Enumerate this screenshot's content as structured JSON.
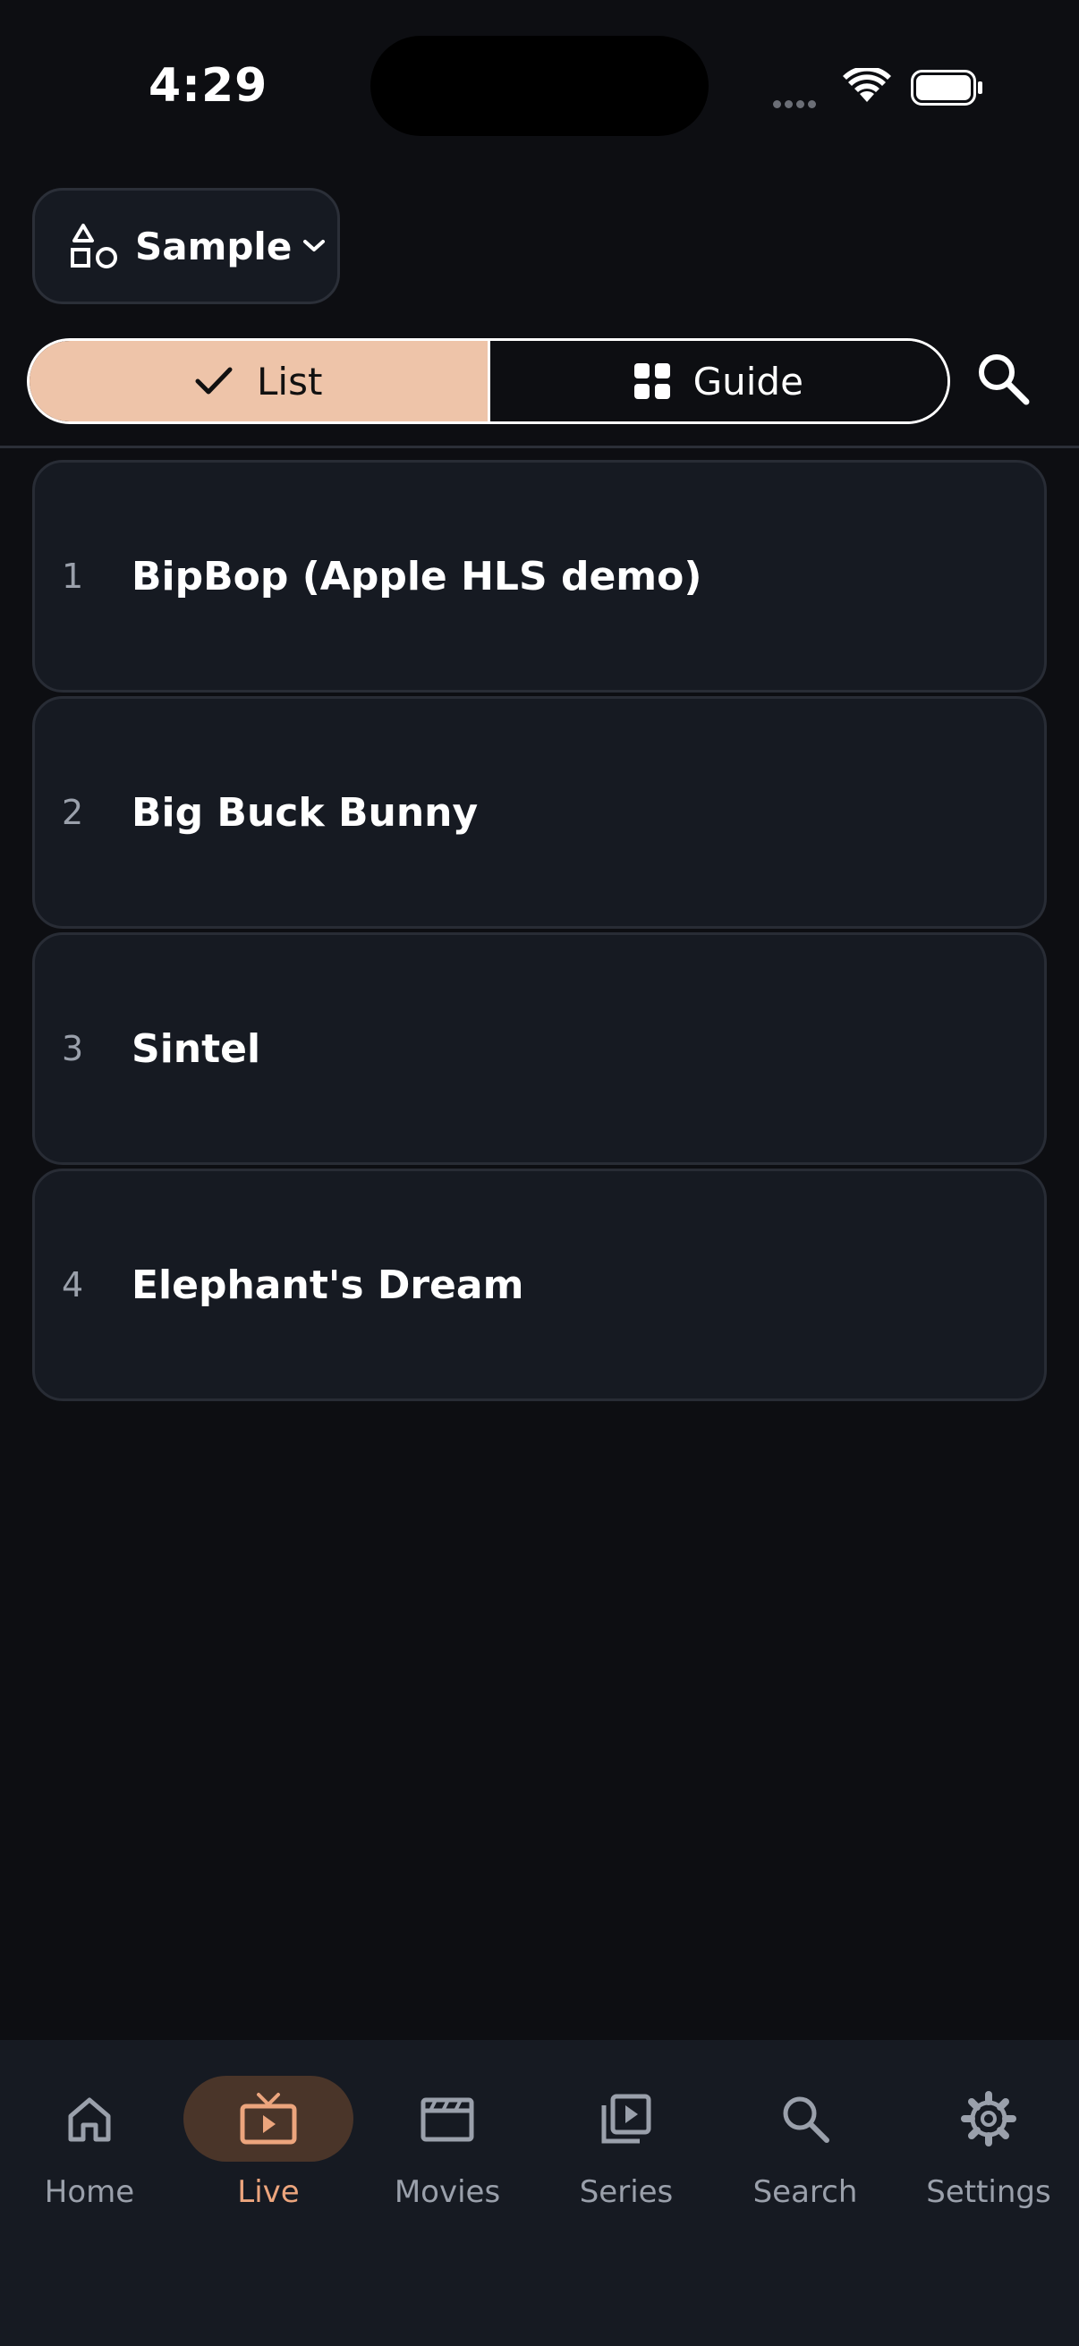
{
  "status_bar": {
    "time": "4:29"
  },
  "playlist_picker": {
    "label": "Sample"
  },
  "view_toggle": {
    "list_label": "List",
    "guide_label": "Guide",
    "selected": "List"
  },
  "channels": [
    {
      "number": "1",
      "name": "BipBop (Apple HLS demo)"
    },
    {
      "number": "2",
      "name": "Big Buck Bunny"
    },
    {
      "number": "3",
      "name": "Sintel"
    },
    {
      "number": "4",
      "name": "Elephant's Dream"
    }
  ],
  "tab_bar": {
    "active": "Live",
    "tabs": [
      {
        "label": "Home",
        "icon": "home-icon"
      },
      {
        "label": "Live",
        "icon": "tv-icon"
      },
      {
        "label": "Movies",
        "icon": "clapperboard-icon"
      },
      {
        "label": "Series",
        "icon": "video-library-icon"
      },
      {
        "label": "Search",
        "icon": "search-icon"
      },
      {
        "label": "Settings",
        "icon": "gear-icon"
      }
    ]
  },
  "colors": {
    "background": "#0d0e12",
    "surface": "#161a22",
    "accent": "#eca57d",
    "segment_selected": "#eec4a9",
    "muted": "#9aa0ab"
  }
}
